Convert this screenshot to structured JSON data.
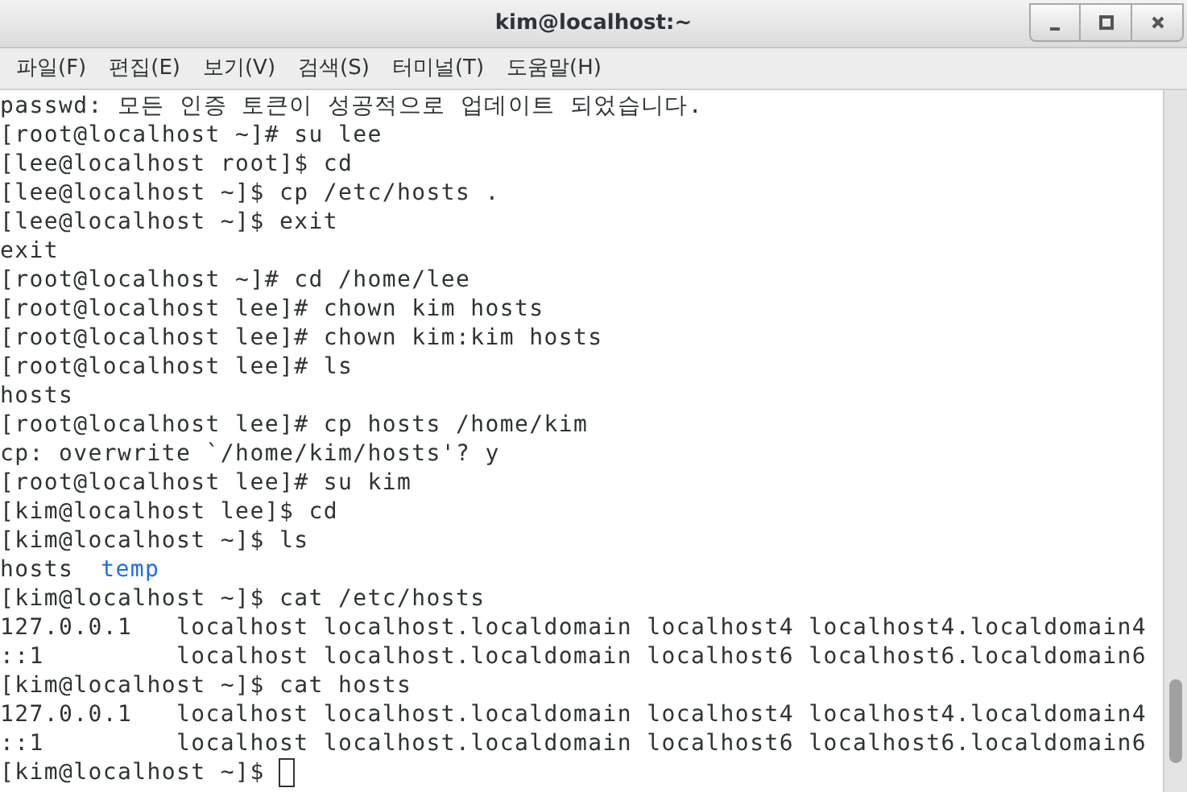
{
  "window": {
    "title": "kim@localhost:~"
  },
  "menu": [
    "파일(F)",
    "편집(E)",
    "보기(V)",
    "검색(S)",
    "터미널(T)",
    "도움말(H)"
  ],
  "terminal": {
    "lines": [
      {
        "text": "passwd: 모든 인증 토큰이 성공적으로 업데이트 되었습니다."
      },
      {
        "text": "[root@localhost ~]# su lee"
      },
      {
        "text": "[lee@localhost root]$ cd"
      },
      {
        "text": "[lee@localhost ~]$ cp /etc/hosts ."
      },
      {
        "text": "[lee@localhost ~]$ exit"
      },
      {
        "text": "exit"
      },
      {
        "text": "[root@localhost ~]# cd /home/lee"
      },
      {
        "text": "[root@localhost lee]# chown kim hosts"
      },
      {
        "text": "[root@localhost lee]# chown kim:kim hosts"
      },
      {
        "text": "[root@localhost lee]# ls"
      },
      {
        "text": "hosts"
      },
      {
        "text": "[root@localhost lee]# cp hosts /home/kim"
      },
      {
        "text": "cp: overwrite `/home/kim/hosts'? y"
      },
      {
        "text": "[root@localhost lee]# su kim"
      },
      {
        "text": "[kim@localhost lee]$ cd"
      },
      {
        "text": "[kim@localhost ~]$ ls"
      },
      {
        "entries": [
          {
            "name": "hosts",
            "kind": "file"
          },
          {
            "name": "temp",
            "kind": "directory"
          }
        ]
      },
      {
        "text": "[kim@localhost ~]$ cat /etc/hosts"
      },
      {
        "text": "127.0.0.1   localhost localhost.localdomain localhost4 localhost4.localdomain4"
      },
      {
        "text": "::1         localhost localhost.localdomain localhost6 localhost6.localdomain6"
      },
      {
        "text": "[kim@localhost ~]$ cat hosts"
      },
      {
        "text": "127.0.0.1   localhost localhost.localdomain localhost4 localhost4.localdomain4"
      },
      {
        "text": "::1         localhost localhost.localdomain localhost6 localhost6.localdomain6"
      },
      {
        "text": "[kim@localhost ~]$ ",
        "cursor": true
      }
    ]
  }
}
